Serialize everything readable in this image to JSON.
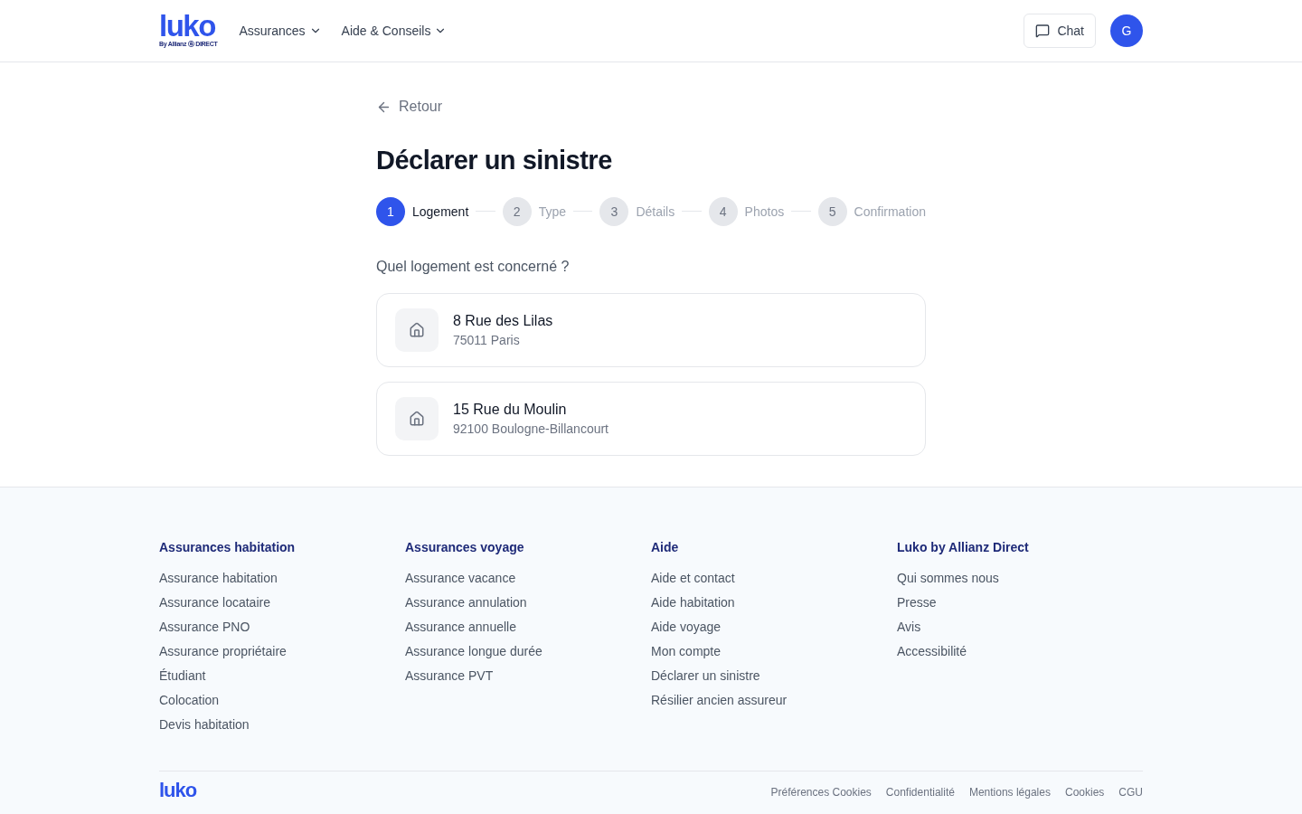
{
  "header": {
    "logo": "luko",
    "logo_tagline": "By Allianz ⓐ DIRECT",
    "nav": [
      {
        "label": "Assurances"
      },
      {
        "label": "Aide & Conseils"
      }
    ],
    "chat_button": "Chat",
    "avatar": "G"
  },
  "back_link": "Retour",
  "title": "Déclarer un sinistre",
  "steps": [
    {
      "number": "1",
      "label": "Logement",
      "selected": true
    },
    {
      "number": "2",
      "label": "Type",
      "selected": false
    },
    {
      "number": "3",
      "label": "Détails",
      "selected": false
    },
    {
      "number": "4",
      "label": "Photos",
      "selected": false
    },
    {
      "number": "5",
      "label": "Confirmation",
      "selected": false
    }
  ],
  "question": "Quel logement est concerné ?",
  "homes": [
    {
      "street": "8 Rue des Lilas",
      "city": "75011 Paris"
    },
    {
      "street": "15 Rue du Moulin",
      "city": "92100 Boulogne-Billancourt"
    }
  ],
  "footer": {
    "columns": [
      {
        "heading": "Assurances habitation",
        "links": [
          "Assurance habitation",
          "Assurance locataire",
          "Assurance PNO",
          "Assurance propriétaire",
          "Étudiant",
          "Colocation",
          "Devis habitation"
        ]
      },
      {
        "heading": "Assurances voyage",
        "links": [
          "Assurance vacance",
          "Assurance annulation",
          "Assurance annuelle",
          "Assurance longue durée",
          "Assurance PVT"
        ]
      },
      {
        "heading": "Aide",
        "links": [
          "Aide et contact",
          "Aide habitation",
          "Aide voyage",
          "Mon compte",
          "Déclarer un sinistre",
          "Résilier ancien assureur"
        ]
      },
      {
        "heading": "Luko by Allianz Direct",
        "links": [
          "Qui sommes nous",
          "Presse",
          "Avis",
          "Accessibilité"
        ]
      }
    ],
    "logo": "luko",
    "legal_links": [
      "Préférences Cookies",
      "Confidentialité",
      "Mentions légales",
      "Cookies",
      "CGU"
    ]
  }
}
